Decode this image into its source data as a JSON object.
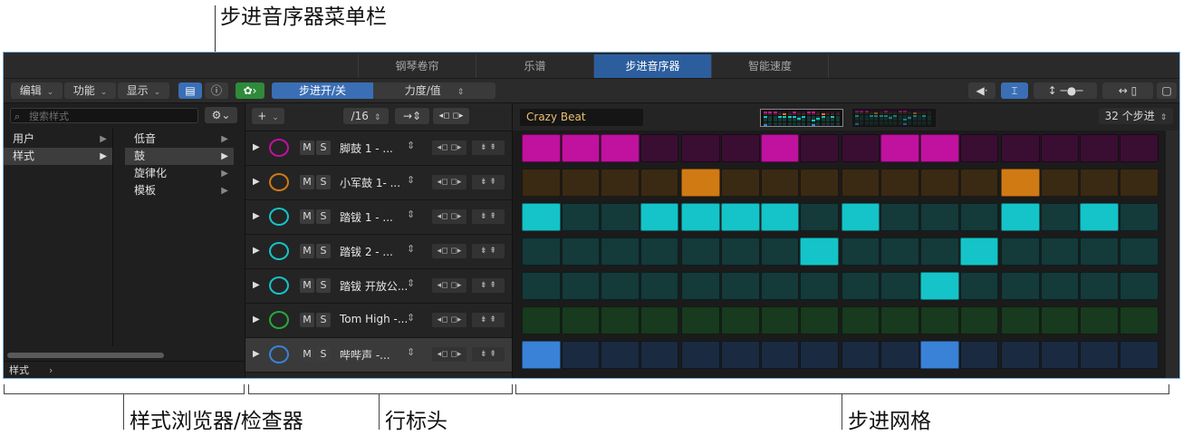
{
  "callouts": {
    "menubar": "步进音序器菜单栏",
    "browser": "样式浏览器/检查器",
    "row_header": "行标头",
    "step_grid": "步进网格"
  },
  "tabs": [
    "钢琴卷帘",
    "乐谱",
    "步进音序器",
    "智能速度"
  ],
  "active_tab": 2,
  "toolbar": {
    "edit": "编辑",
    "functions": "功能",
    "view": "显示",
    "step_on_off": "步进开/关",
    "velocity": "力度/值"
  },
  "browser": {
    "search_placeholder": "搜索样式",
    "col1": [
      "用户",
      "样式"
    ],
    "col1_selected": 1,
    "col2": [
      "低音",
      "鼓",
      "旋律化",
      "模板"
    ],
    "col2_selected": 1,
    "footer": "样式"
  },
  "row_tools": {
    "add": "+",
    "rate": "/16"
  },
  "rows": [
    {
      "name": "脚鼓 1 - ...",
      "icon": "kick-drum-icon",
      "color": "#c0119f",
      "dim": "#3a0e33",
      "steps": [
        1,
        1,
        1,
        0,
        0,
        0,
        1,
        0,
        0,
        1,
        1,
        0,
        0,
        0,
        0,
        0
      ]
    },
    {
      "name": "小军鼓 1- ...",
      "icon": "snare-drum-icon",
      "color": "#d07a14",
      "dim": "#3a2a14",
      "steps": [
        0,
        0,
        0,
        0,
        1,
        0,
        0,
        0,
        0,
        0,
        0,
        0,
        1,
        0,
        0,
        0
      ]
    },
    {
      "name": "踏钹 1 - ...",
      "icon": "hihat-closed-icon",
      "color": "#14c4c8",
      "dim": "#143a3a",
      "steps": [
        1,
        0,
        0,
        1,
        1,
        1,
        1,
        0,
        1,
        0,
        0,
        0,
        1,
        0,
        1,
        0
      ]
    },
    {
      "name": "踏钹 2 - ...",
      "icon": "hihat-pedal-icon",
      "color": "#14c4c8",
      "dim": "#143a3a",
      "steps": [
        0,
        0,
        0,
        0,
        0,
        0,
        0,
        1,
        0,
        0,
        0,
        1,
        0,
        0,
        0,
        0
      ]
    },
    {
      "name": "踏钹 开放公...",
      "icon": "hihat-open-icon",
      "color": "#14c4c8",
      "dim": "#143a3a",
      "steps": [
        0,
        0,
        0,
        0,
        0,
        0,
        0,
        0,
        0,
        0,
        1,
        0,
        0,
        0,
        0,
        0
      ]
    },
    {
      "name": "Tom High -...",
      "icon": "tom-drum-icon",
      "color": "#2aa83a",
      "dim": "#183a1e",
      "steps": [
        0,
        0,
        0,
        0,
        0,
        0,
        0,
        0,
        0,
        0,
        0,
        0,
        0,
        0,
        0,
        0
      ]
    },
    {
      "name": "哔哔声 -...",
      "icon": "beep-drum-icon",
      "color": "#3a82d8",
      "dim": "#1a2a40",
      "steps": [
        1,
        0,
        0,
        0,
        0,
        0,
        0,
        0,
        0,
        0,
        1,
        0,
        0,
        0,
        0,
        0
      ]
    }
  ],
  "selected_row": 6,
  "pattern_name": "Crazy Beat",
  "steps_count": "32 个步进"
}
